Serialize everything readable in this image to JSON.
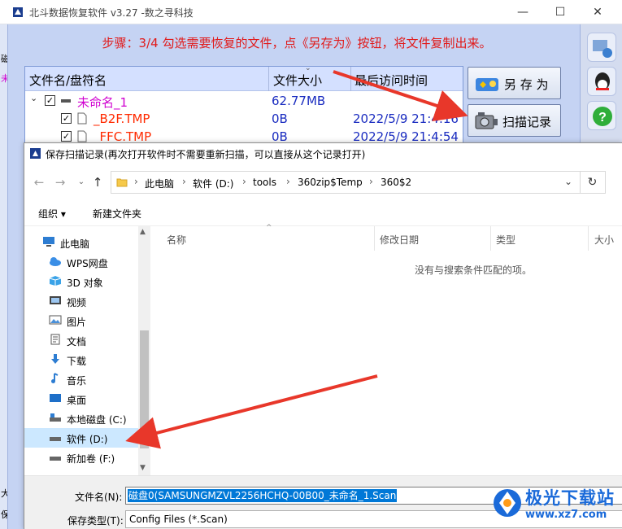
{
  "app": {
    "title": "北斗数据恢复软件 v3.27  -数之寻科技",
    "step_text": "步骤：3/4 勾选需要恢复的文件，点《另存为》按钮，将文件复制出来。",
    "columns": [
      "文件名/盘符名",
      "文件大小",
      "最后访问时间"
    ],
    "rows": [
      {
        "name": "未命名_1",
        "size": "62.77MB",
        "time": ""
      },
      {
        "name": "_B2F.TMP",
        "size": "0B",
        "time": "2022/5/9 21:4:16"
      },
      {
        "name": "_FFC.TMP",
        "size": "0B",
        "time": "2022/5/9 21:4:54"
      }
    ],
    "saveas_label": "另 存 为",
    "scan_record_label": "扫描记录",
    "left_strip_marks": [
      "磁",
      "未",
      "大",
      "保"
    ]
  },
  "dialog": {
    "title": "保存扫描记录(再次打开软件时不需要重新扫描，可以直接从这个记录打开)",
    "breadcrumb": [
      "此电脑",
      "软件 (D:)",
      "tools",
      "360zip$Temp",
      "360$2"
    ],
    "toolbar": {
      "organize": "组织 ▾",
      "new_folder": "新建文件夹"
    },
    "nav_items": [
      {
        "label": "此电脑",
        "icon": "computer-icon"
      },
      {
        "label": "WPS网盘",
        "icon": "cloud-icon"
      },
      {
        "label": "3D 对象",
        "icon": "cube-icon"
      },
      {
        "label": "视频",
        "icon": "video-icon"
      },
      {
        "label": "图片",
        "icon": "picture-icon"
      },
      {
        "label": "文档",
        "icon": "document-icon"
      },
      {
        "label": "下载",
        "icon": "download-icon"
      },
      {
        "label": "音乐",
        "icon": "music-icon"
      },
      {
        "label": "桌面",
        "icon": "desktop-icon"
      },
      {
        "label": "本地磁盘 (C:)",
        "icon": "drive-icon"
      },
      {
        "label": "软件 (D:)",
        "icon": "drive-icon"
      },
      {
        "label": "新加卷 (F:)",
        "icon": "drive-icon"
      }
    ],
    "columns": [
      "名称",
      "修改日期",
      "类型",
      "大小"
    ],
    "empty_message": "没有与搜索条件匹配的项。",
    "filename_label": "文件名(N):",
    "filename_value": "磁盘0(SAMSUNGMZVL2256HCHQ-00B00_未命名_1.Scan",
    "filetype_label": "保存类型(T):",
    "filetype_value": "Config Files (*.Scan)"
  },
  "watermark": {
    "line1": "极光下载站",
    "line2": "www.xz7.com"
  },
  "colors": {
    "step_red": "#e11a1a",
    "arrow_red": "#e8372a",
    "selection_blue": "#0078d7"
  }
}
